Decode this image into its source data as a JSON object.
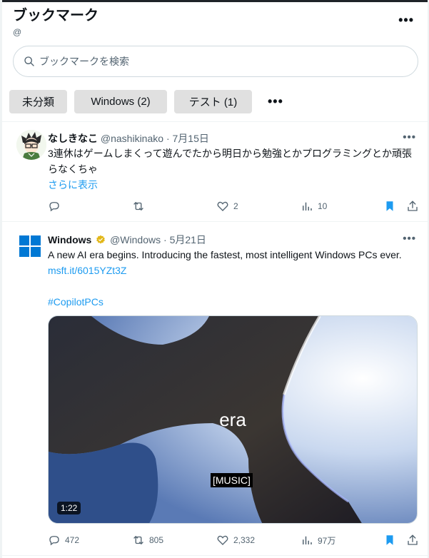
{
  "header": {
    "title": "ブックマーク",
    "handle": "@",
    "more_icon": "more-icon"
  },
  "search": {
    "placeholder": "ブックマークを検索",
    "icon": "search-icon"
  },
  "folders": [
    {
      "label": "未分類"
    },
    {
      "label": "Windows (2)"
    },
    {
      "label": "テスト (1)"
    }
  ],
  "folder_more": "•••",
  "tweets": [
    {
      "name": "なしきなこ",
      "handle": "@nashikinako",
      "date": "7月15日",
      "text": "3連休はゲームしまくって遊んでたから明日から勉強とかプログラミングとか頑張らなくちゃ",
      "show_more": "さらに表示",
      "replies": "",
      "retweets": "",
      "likes": "2",
      "views": "10",
      "bookmarked": true
    },
    {
      "name": "Windows",
      "handle": "@Windows",
      "date": "5月21日",
      "text": "A new AI era begins. Introducing the fastest, most intelligent Windows PCs ever. ",
      "link": "msft.it/6015YZt3Z",
      "hashtag": "#CopilotPCs",
      "media": {
        "caption": "era",
        "subtitle": "[MUSIC]",
        "duration": "1:22"
      },
      "replies": "472",
      "retweets": "805",
      "likes": "2,332",
      "views": "97万",
      "bookmarked": true
    }
  ],
  "colors": {
    "accent": "#1d9bf0",
    "muted": "#536471",
    "text": "#0f1419",
    "folder_bg": "#e0e0e0",
    "windows_blue": "#0078d4"
  }
}
